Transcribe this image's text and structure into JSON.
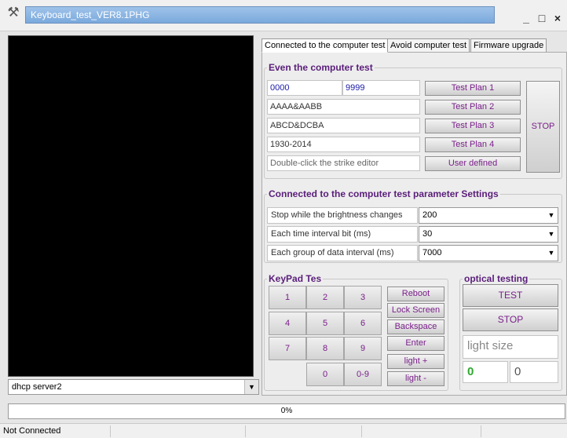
{
  "window": {
    "title": "Keyboard_test_VER8.1PHG",
    "minimize": "_",
    "maximize": "□",
    "close": "×"
  },
  "left": {
    "device_select": {
      "value": "dhcp server2"
    }
  },
  "tabs": [
    {
      "label": "Connected to the computer test",
      "active": true
    },
    {
      "label": "Avoid computer test",
      "active": false
    },
    {
      "label": "Firmware upgrade",
      "active": false
    }
  ],
  "even_test": {
    "title": "Even the computer test",
    "field_from": "0000",
    "field_to": "9999",
    "fields": [
      "AAAA&AABB",
      "ABCD&DCBA",
      "1930-2014"
    ],
    "editor_placeholder": "Double-click the strike editor",
    "buttons": [
      "Test Plan 1",
      "Test Plan 2",
      "Test Plan 3",
      "Test Plan 4",
      "User defined"
    ],
    "stop_label": "STOP"
  },
  "params": {
    "title": "Connected to the computer test parameter Settings",
    "rows": [
      {
        "label": "Stop while the brightness changes",
        "value": "200"
      },
      {
        "label": "Each time interval bit (ms)",
        "value": "30"
      },
      {
        "label": "Each group of data interval (ms)",
        "value": "7000"
      }
    ]
  },
  "keypad": {
    "title": "KeyPad Tes",
    "keys": [
      "1",
      "2",
      "3",
      "4",
      "5",
      "6",
      "7",
      "8",
      "9",
      "0",
      "0-9"
    ],
    "actions": [
      "Reboot",
      "Lock Screen",
      "Backspace",
      "Enter",
      "light +",
      "light -"
    ]
  },
  "optical": {
    "title": "optical testing",
    "test_label": "TEST",
    "stop_label": "STOP",
    "size_placeholder": "light size",
    "value_left": "0",
    "value_right": "0"
  },
  "progress": {
    "label": "0%",
    "value": 0
  },
  "status": {
    "text": "Not Connected"
  },
  "colors": {
    "accent_purple": "#7a1f8a",
    "title_bar_blue": "#8db6e4",
    "legend_purple": "#5a1e7a"
  }
}
